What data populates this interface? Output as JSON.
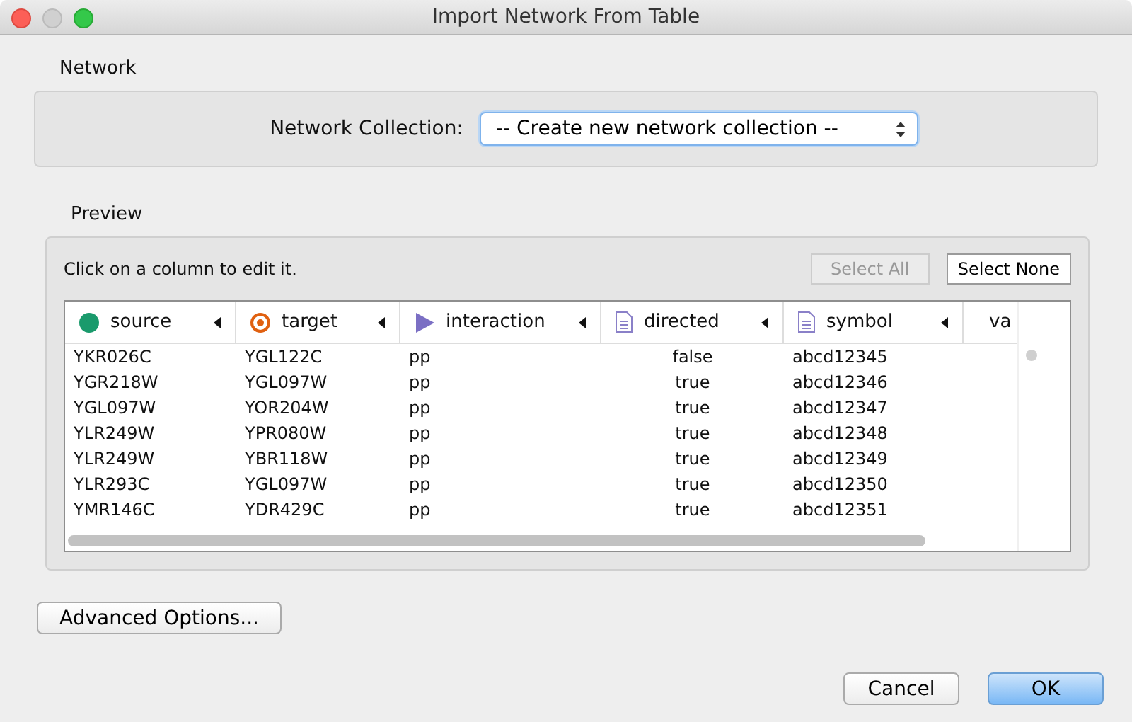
{
  "window": {
    "title": "Import Network From Table"
  },
  "network": {
    "title": "Network",
    "collection_label": "Network Collection:",
    "collection_value": "-- Create new network collection --"
  },
  "preview": {
    "title": "Preview",
    "hint": "Click on a column to edit it.",
    "buttons": [
      {
        "label": "Select All",
        "disabled": true
      },
      {
        "label": "Select None",
        "disabled": false
      }
    ],
    "columns": [
      {
        "label": "source",
        "kind": "source"
      },
      {
        "label": "target",
        "kind": "target"
      },
      {
        "label": "interaction",
        "kind": "interaction"
      },
      {
        "label": "directed",
        "kind": "attribute"
      },
      {
        "label": "symbol",
        "kind": "attribute"
      },
      {
        "label": "va",
        "kind": "attribute"
      }
    ],
    "rows": [
      [
        "YKR026C",
        "YGL122C",
        "pp",
        "false",
        "abcd12345"
      ],
      [
        "YGR218W",
        "YGL097W",
        "pp",
        "true",
        "abcd12346"
      ],
      [
        "YGL097W",
        "YOR204W",
        "pp",
        "true",
        "abcd12347"
      ],
      [
        "YLR249W",
        "YPR080W",
        "pp",
        "true",
        "abcd12348"
      ],
      [
        "YLR249W",
        "YBR118W",
        "pp",
        "true",
        "abcd12349"
      ],
      [
        "YLR293C",
        "YGL097W",
        "pp",
        "true",
        "abcd12350"
      ],
      [
        "YMR146C",
        "YDR429C",
        "pp",
        "true",
        "abcd12351"
      ]
    ]
  },
  "advanced_button": "Advanced Options...",
  "dialog_buttons": [
    {
      "label": "Cancel",
      "default": false
    },
    {
      "label": "OK",
      "default": true
    }
  ]
}
